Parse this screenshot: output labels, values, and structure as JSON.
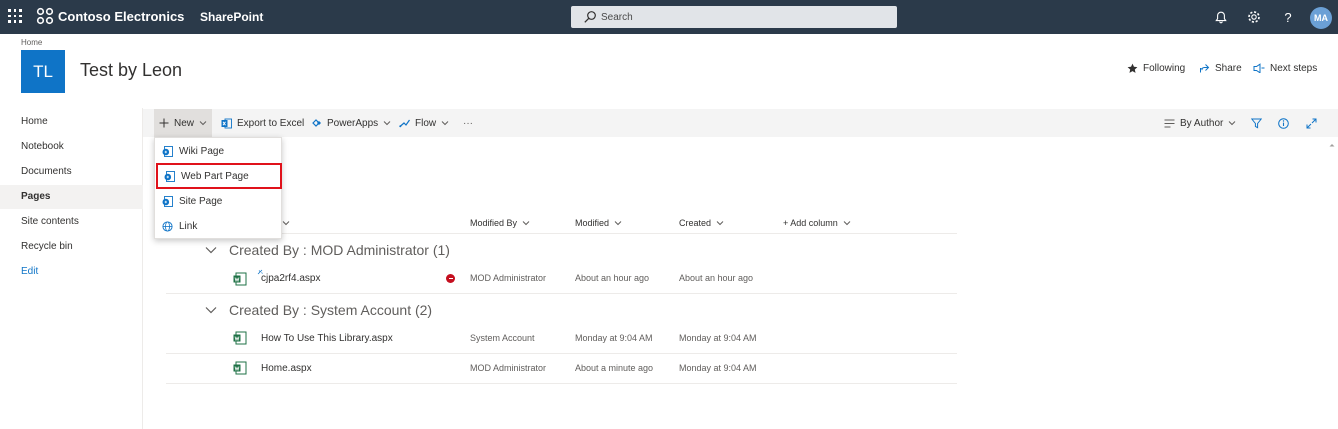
{
  "suite": {
    "org_name": "Contoso Electronics",
    "app_name": "SharePoint",
    "search_placeholder": "Search",
    "avatar_initials": "MA"
  },
  "site": {
    "breadcrumb": "Home",
    "logo_initials": "TL",
    "title": "Test by Leon",
    "actions": {
      "following": "Following",
      "share": "Share",
      "next_steps": "Next steps"
    }
  },
  "left_nav": {
    "items": [
      {
        "label": "Home",
        "active": false
      },
      {
        "label": "Notebook",
        "active": false
      },
      {
        "label": "Documents",
        "active": false
      },
      {
        "label": "Pages",
        "active": true
      },
      {
        "label": "Site contents",
        "active": false
      },
      {
        "label": "Recycle bin",
        "active": false
      },
      {
        "label": "Edit",
        "active": false
      }
    ]
  },
  "command_bar": {
    "new": "New",
    "export": "Export to Excel",
    "powerapps": "PowerApps",
    "flow": "Flow",
    "more": "···",
    "view": "By Author"
  },
  "new_menu": {
    "items": [
      {
        "label": "Wiki Page",
        "icon": "page-icon"
      },
      {
        "label": "Web Part Page",
        "icon": "page-icon",
        "highlighted": true
      },
      {
        "label": "Site Page",
        "icon": "page-icon"
      },
      {
        "label": "Link",
        "icon": "globe-icon"
      }
    ]
  },
  "list": {
    "columns": {
      "modified_by": "Modified By",
      "modified": "Modified",
      "created": "Created",
      "add_column": "+ Add column"
    },
    "groups": [
      {
        "title": "Created By : MOD Administrator (1)",
        "rows": [
          {
            "name": "cjpa2rf4.aspx",
            "modified_by": "MOD Administrator",
            "modified": "About an hour ago",
            "created": "About an hour ago"
          }
        ]
      },
      {
        "title": "Created By : System Account (2)",
        "rows": [
          {
            "name": "How To Use This Library.aspx",
            "modified_by": "System Account",
            "modified": "Monday at 9:04 AM",
            "created": "Monday at 9:04 AM"
          },
          {
            "name": "Home.aspx",
            "modified_by": "MOD Administrator",
            "modified": "About a minute ago",
            "created": "Monday at 9:04 AM"
          }
        ]
      }
    ]
  },
  "colors": {
    "suite_bar": "#2b3a4a",
    "brand_blue": "#0f74c7",
    "highlight_red": "#e0121b",
    "error_red": "#c50f1f"
  }
}
